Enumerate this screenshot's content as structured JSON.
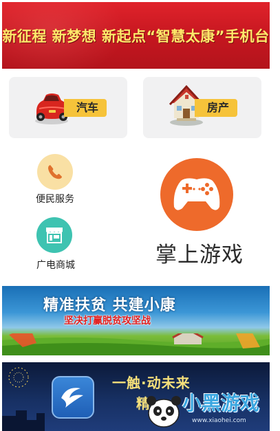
{
  "banner_top": {
    "title": "新征程 新梦想 新起点“智慧太康”手机台"
  },
  "tiles": {
    "car": {
      "label": "汽车",
      "icon": "red-car-icon"
    },
    "house": {
      "label": "房产",
      "icon": "house-icon"
    }
  },
  "services": [
    {
      "label": "便民服务",
      "icon": "phone-icon"
    },
    {
      "label": "广电商城",
      "icon": "shop-icon"
    }
  ],
  "game": {
    "label": "掌上游戏",
    "icon": "gamepad-icon"
  },
  "banner_poverty": {
    "headline": "精准扶贫 共建小康",
    "subline": "坚决打赢脱贫攻坚战"
  },
  "banner_app": {
    "slogan": "一触·动未来",
    "slogan2": "精"
  },
  "watermark": {
    "text": "小黑游戏",
    "url": "www.xiaohei.com"
  },
  "colors": {
    "banner_red": "#c4161f",
    "banner_text": "#ffe86a",
    "tag_yellow": "#f6c33a",
    "game_orange": "#ee6a2b",
    "shop_teal": "#3ec3b1",
    "phone_bg": "#f9e0a4"
  }
}
